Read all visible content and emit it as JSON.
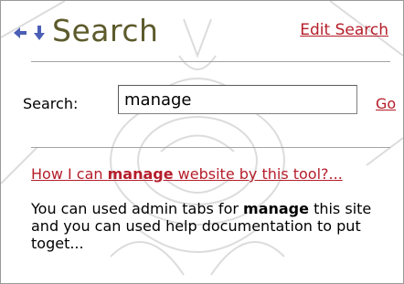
{
  "header": {
    "title": "Search",
    "edit_search_label": "Edit Search",
    "back_icon": "arrow-left-icon",
    "down_icon": "arrow-down-icon",
    "icon_color": "#4a5fb5"
  },
  "search": {
    "label": "Search:",
    "value": "manage",
    "go_label": "Go"
  },
  "results": [
    {
      "title_before": "How I can ",
      "title_match": "manage",
      "title_after": " website by this tool?...",
      "snippet_before": "You can used admin tabs for ",
      "snippet_match": "manage",
      "snippet_after": " this site and you can used help documentation to put toget..."
    }
  ],
  "colors": {
    "link": "#b51d2a",
    "title": "#5d5a2c",
    "rule": "#a3a3a3"
  }
}
